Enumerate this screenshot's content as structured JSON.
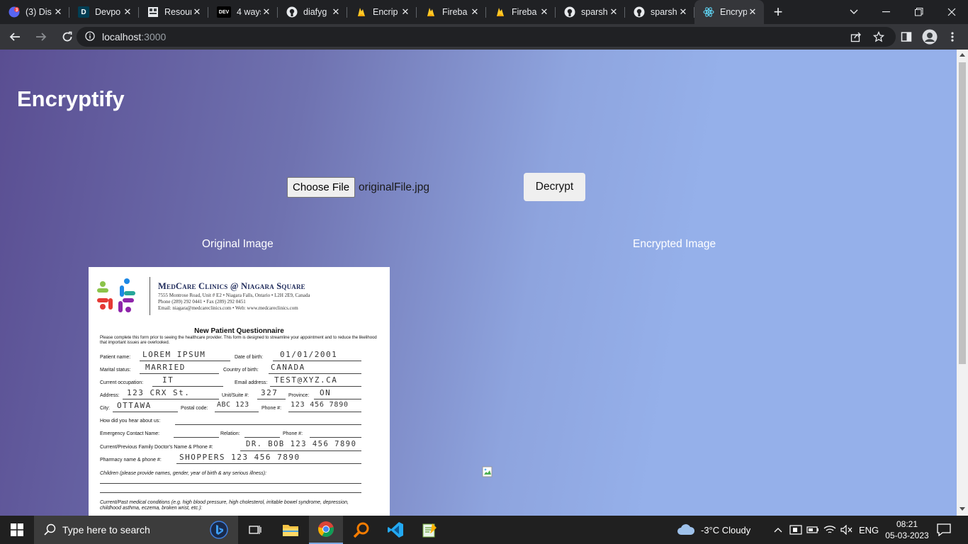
{
  "browser": {
    "tabs": [
      {
        "title": "(3) Dis",
        "favicon": "discord-icon"
      },
      {
        "title": "Devpo",
        "favicon": "devpost-icon"
      },
      {
        "title": "Resour",
        "favicon": "resource-icon"
      },
      {
        "title": "4 ways",
        "favicon": "dev-icon"
      },
      {
        "title": "diafyg",
        "favicon": "github-icon"
      },
      {
        "title": "Encrip",
        "favicon": "firebase-icon"
      },
      {
        "title": "Fireba",
        "favicon": "firebase-icon"
      },
      {
        "title": "Fireba",
        "favicon": "firebase-icon"
      },
      {
        "title": "sparsh",
        "favicon": "github-icon"
      },
      {
        "title": "sparsh",
        "favicon": "github-icon"
      },
      {
        "title": "Encryp",
        "favicon": "react-icon",
        "active": true
      }
    ],
    "tab_badge": "3",
    "dev_label": "DEV",
    "devpost_label": "D",
    "url_host": "localhost",
    "url_port": ":3000"
  },
  "page": {
    "app_title": "Encryptify",
    "choose_file_label": "Choose File",
    "file_name": "originalFile.jpg",
    "decrypt_label": "Decrypt",
    "original_heading": "Original Image",
    "encrypted_heading": "Encrypted Image"
  },
  "document": {
    "clinic_name": "MedCare Clinics @ Niagara Square",
    "address_line": "7555 Montrose Road, Unit # E2 • Niagara Falls, Ontario • L2H 2E9, Canada",
    "phone_line": "Phone (289) 292 0441 • Fax (289) 292 0451",
    "email_line": "Email: niagara@medcareclinics.com • Web: www.medcareclinics.com",
    "form_title": "New Patient Questionnaire",
    "intro": "Please complete this form prior to seeing the healthcare provider. This form is designed to streamline your appointment and to reduce the likelihood that important issues are overlooked.",
    "labels": {
      "patient_name": "Patient name:",
      "dob": "Date of birth:",
      "marital": "Marital status:",
      "country": "Country of birth:",
      "occupation": "Current occupation:",
      "email": "Email address:",
      "address": "Address:",
      "unit": "Unit/Suite #:",
      "province": "Province:",
      "city": "City:",
      "postal": "Postal code:",
      "phone": "Phone #:",
      "hear": "How did you hear about us:",
      "emergency": "Emergency Contact Name:",
      "relation": "Relation:",
      "phone2": "Phone #:",
      "doctor": "Current/Previous Family Doctor's Name & Phone #:",
      "pharmacy": "Pharmacy name & phone #:",
      "children": "Children (please provide names, gender, year of birth & any serious illness):",
      "conditions": "Current/Past medical conditions (e.g. high blood pressure, high cholesterol, irritable bowel syndrome, depression, childhood asthma, eczema, broken wrist, etc.):"
    },
    "values": {
      "patient_name": "LOREM IPSUM",
      "dob": "01/01/2001",
      "marital": "MARRIED",
      "country": "CANADA",
      "occupation": "IT",
      "email": "TEST@XYZ.CA",
      "address": "123 CRX St.",
      "unit": "327",
      "province": "ON",
      "city": "OTTAWA",
      "postal": "ABC 123",
      "phone": "123 456 7890",
      "doctor": "DR. BOB  123 456 7890",
      "pharmacy": "SHOPPERS  123 456 7890"
    }
  },
  "taskbar": {
    "search_placeholder": "Type here to search",
    "weather": "-3°C  Cloudy",
    "language": "ENG",
    "time": "08:21",
    "date": "05-03-2023"
  }
}
